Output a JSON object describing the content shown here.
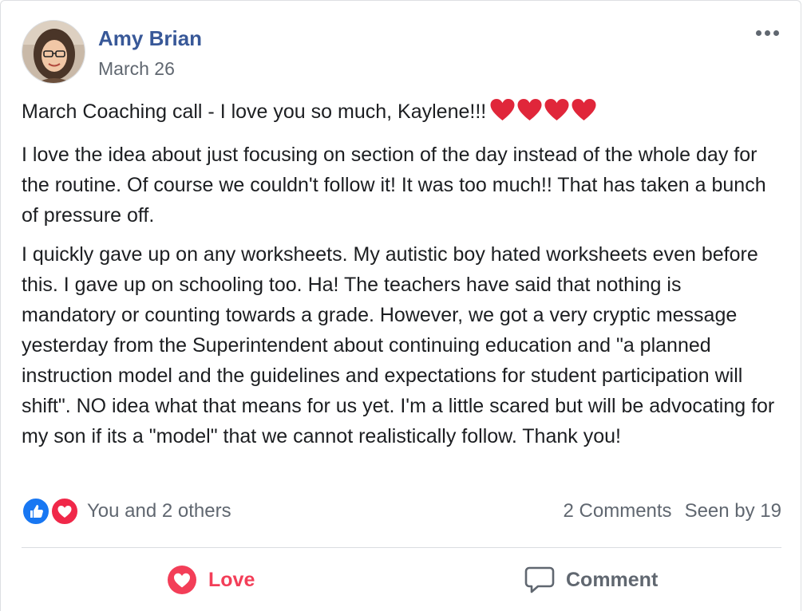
{
  "post": {
    "author": "Amy Brian",
    "date": "March 26",
    "paragraphs": [
      "March Coaching call - I love you so much, Kaylene!!!",
      "I love the idea about just focusing on section of the day instead of the whole day for the routine. Of course we couldn't follow it! It was too much!! That has taken a bunch of pressure off.",
      "I quickly gave up on any worksheets. My autistic boy hated worksheets even before this. I gave up on schooling too. Ha! The teachers have said that nothing is mandatory or counting towards a grade. However, we got a very cryptic message yesterday from the Superintendent about continuing education and \"a planned instruction model and the guidelines and expectations for student participation will shift\". NO idea what that means for us yet. I'm a little scared but will be advocating for my son if its a \"model\" that we cannot realistically follow. Thank you!"
    ],
    "emoji": [
      "heart-emoji",
      "heart-emoji",
      "heart-emoji",
      "heart-emoji"
    ]
  },
  "reactions": {
    "icons": [
      "like-reaction-icon",
      "love-reaction-icon"
    ],
    "summary": "You and 2 others",
    "comments": "2 Comments",
    "seen": "Seen by 19"
  },
  "actions": {
    "love_label": "Love",
    "comment_label": "Comment"
  },
  "colors": {
    "author": "#385898",
    "love": "#f33e58",
    "like": "#1877f2",
    "muted": "#606770",
    "heart_emoji": "#e0263a"
  }
}
